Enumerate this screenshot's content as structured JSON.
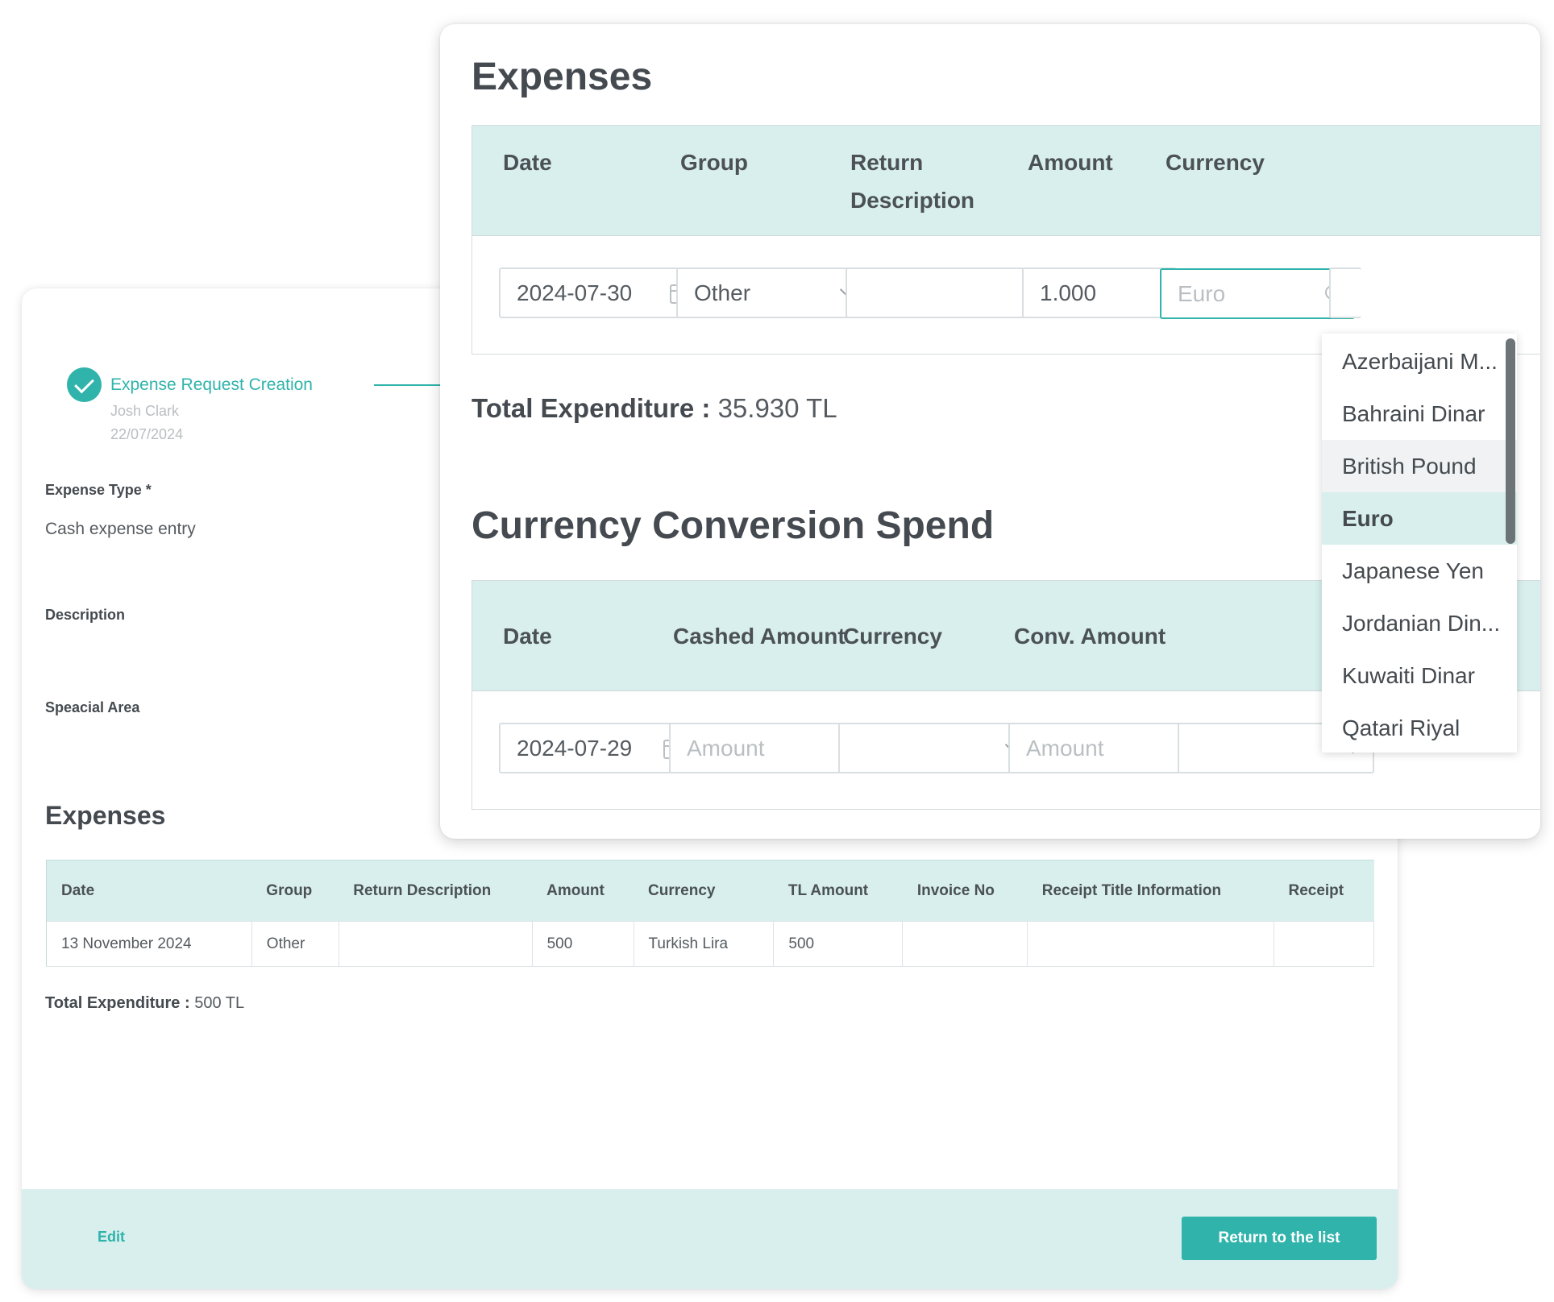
{
  "back": {
    "step": {
      "title": "Expense Request Creation",
      "user": "Josh Clark",
      "date": "22/07/2024"
    },
    "fields": {
      "expense_type_label": "Expense Type *",
      "expense_type_value": "Cash expense entry",
      "description_label": "Description",
      "special_area_label": "Speacial Area"
    },
    "expenses_title": "Expenses",
    "table": {
      "headers": [
        "Date",
        "Group",
        "Return Description",
        "Amount",
        "Currency",
        "TL Amount",
        "Invoice No",
        "Receipt Title Information",
        "Receipt"
      ],
      "rows": [
        [
          "13 November 2024",
          "Other",
          "",
          "500",
          "Turkish Lira",
          "500",
          "",
          "",
          ""
        ]
      ]
    },
    "total_label": "Total Expenditure :",
    "total_value": "500 TL",
    "footer": {
      "edit": "Edit",
      "return": "Return to the list"
    }
  },
  "front": {
    "expenses_title": "Expenses",
    "expenses_headers": [
      "Date",
      "Group",
      "Return Description",
      "Amount",
      "Currency"
    ],
    "expense_row": {
      "date": "2024-07-30",
      "group": "Other",
      "return_description": "",
      "amount": "1.000",
      "currency_placeholder": "Euro"
    },
    "total_label": "Total Expenditure :",
    "total_value": "35.930 TL",
    "conversion_title": "Currency Conversion Spend",
    "conversion_headers": [
      "Date",
      "Cashed Amount",
      "Currency",
      "Conv. Amount"
    ],
    "conversion_row": {
      "date": "2024-07-29",
      "cashed_amount_placeholder": "Amount",
      "currency": "",
      "conv_amount_placeholder": "Amount"
    },
    "currency_dropdown": {
      "options": [
        "Azerbaijani M...",
        "Bahraini Dinar",
        "British Pound",
        "Euro",
        "Japanese Yen",
        "Jordanian Din...",
        "Kuwaiti Dinar",
        "Qatari Riyal"
      ],
      "hovered": "British Pound",
      "selected": "Euro"
    }
  },
  "colors": {
    "accent": "#2fb3ab",
    "header_bg": "#d8efed",
    "text": "#444a4f",
    "muted": "#b9bec1"
  }
}
